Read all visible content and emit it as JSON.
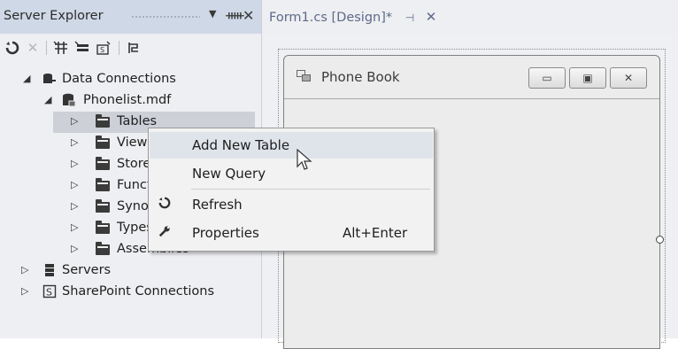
{
  "server_explorer": {
    "title": "Server Explorer",
    "pin_icon": "pin-icon",
    "close_icon": "close-icon",
    "dropdown_icon": "dropdown-arrow-icon",
    "toolbar": [
      "refresh-icon",
      "stop-icon",
      "connect-to-database-icon",
      "connect-to-server-icon",
      "connect-to-sharepoint-icon",
      "properties-icon"
    ],
    "tree": {
      "data_connections": "Data Connections",
      "database": "Phonelist.mdf",
      "children": [
        "Tables",
        "Views",
        "Stored Procedures",
        "Functions",
        "Synonyms",
        "Types",
        "Assemblies"
      ],
      "servers": "Servers",
      "sharepoint": "SharePoint Connections"
    }
  },
  "editor": {
    "tab_label": "Form1.cs [Design]*",
    "form_title": "Phone Book"
  },
  "context_menu": {
    "items": [
      {
        "label": "Add New Table",
        "shortcut": "",
        "icon": ""
      },
      {
        "label": "New Query",
        "shortcut": "",
        "icon": ""
      },
      {
        "label": "Refresh",
        "shortcut": "",
        "icon": "refresh-icon"
      },
      {
        "label": "Properties",
        "shortcut": "Alt+Enter",
        "icon": "wrench-icon"
      }
    ]
  }
}
